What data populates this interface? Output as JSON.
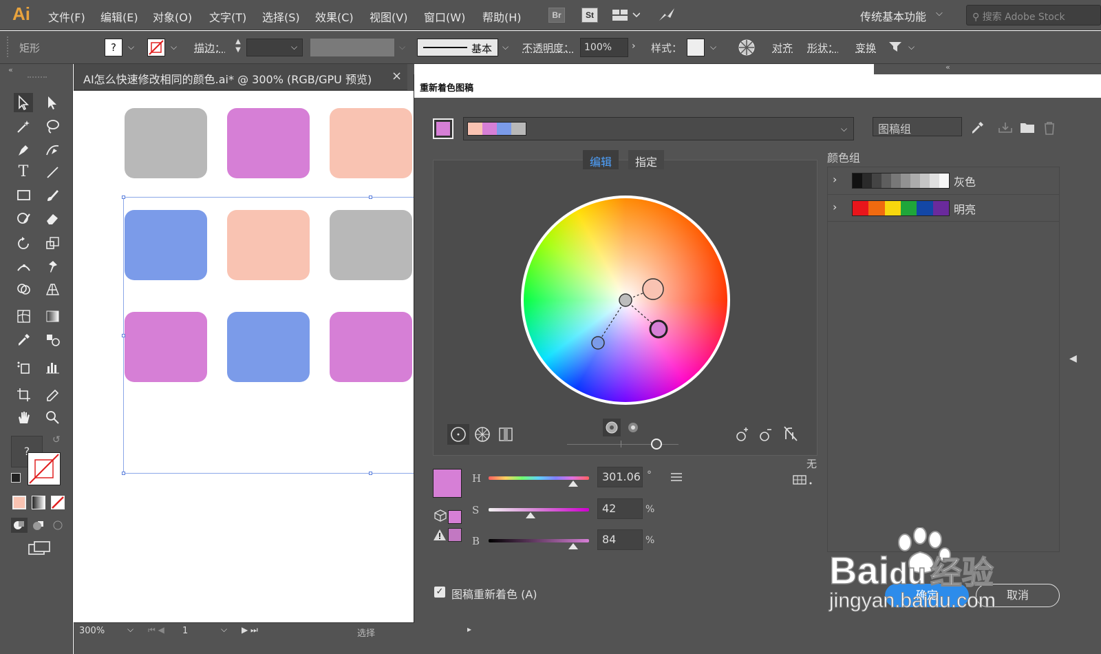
{
  "app": {
    "logo": "Ai",
    "accent": "#e8a33d"
  },
  "menubar": {
    "items": [
      "文件(F)",
      "编辑(E)",
      "对象(O)",
      "文字(T)",
      "选择(S)",
      "效果(C)",
      "视图(V)",
      "窗口(W)",
      "帮助(H)"
    ],
    "bridge_label": "Br",
    "stock_label": "St",
    "workspace": "传统基本功能",
    "search_placeholder": "搜索 Adobe Stock"
  },
  "controlbar": {
    "object_type": "矩形",
    "fill_label": "?",
    "stroke_label": "描边：",
    "brush_label": "基本",
    "opacity_label": "不透明度：",
    "opacity_value": "100%",
    "style_label": "样式：",
    "align_label": "对齐",
    "shape_label": "形状：",
    "transform_label": "变换"
  },
  "document": {
    "tab_title": "AI怎么快速修改相同的颜色.ai* @ 300% (RGB/GPU 预览)",
    "close": "×",
    "swatches": [
      [
        "#b8b8b8",
        "#d67fd6",
        "#f9c3b2"
      ],
      [
        "#7b9be9",
        "#f9c3b2",
        "#b8b8b8"
      ],
      [
        "#d67fd6",
        "#7b9be9",
        "#d67fd6"
      ]
    ]
  },
  "statusbar": {
    "zoom": "300%",
    "artboard": "1",
    "tool": "选择"
  },
  "dialog": {
    "title": "重新着色图稿",
    "current_color": "#d67fd6",
    "strip_colors": [
      "#f9c3b2",
      "#d67fd6",
      "#7b9be9",
      "#b8b8b8"
    ],
    "group_name": "图稿组",
    "tabs": {
      "edit": "编辑",
      "assign": "指定"
    },
    "none_label": "无",
    "hsb": {
      "h_label": "H",
      "h_value": "301.06",
      "h_unit": "°",
      "h_fraction": 0.84,
      "s_label": "S",
      "s_value": "42",
      "s_unit": "%",
      "s_fraction": 0.42,
      "b_label": "B",
      "b_value": "84",
      "b_unit": "%",
      "b_fraction": 0.84
    },
    "recolor_checkbox": {
      "label": "图稿重新着色 (A)",
      "checked": true
    },
    "ok": "确定",
    "cancel": "取消",
    "color_groups_label": "颜色组",
    "color_groups": [
      {
        "name": "灰色",
        "colors": [
          "#111111",
          "#2a2a2a",
          "#444444",
          "#5e5e5e",
          "#787878",
          "#929292",
          "#acacac",
          "#c6c6c6",
          "#e0e0e0",
          "#f8f8f8"
        ]
      },
      {
        "name": "明亮",
        "colors": [
          "#e8151b",
          "#f06a0f",
          "#f7d70e",
          "#1fa63a",
          "#1347a6",
          "#6a2a9c"
        ]
      }
    ]
  },
  "watermark": {
    "brand": "Bai",
    "brand2": "du",
    "cn": "经验",
    "url": "jingyan.baidu.com"
  }
}
